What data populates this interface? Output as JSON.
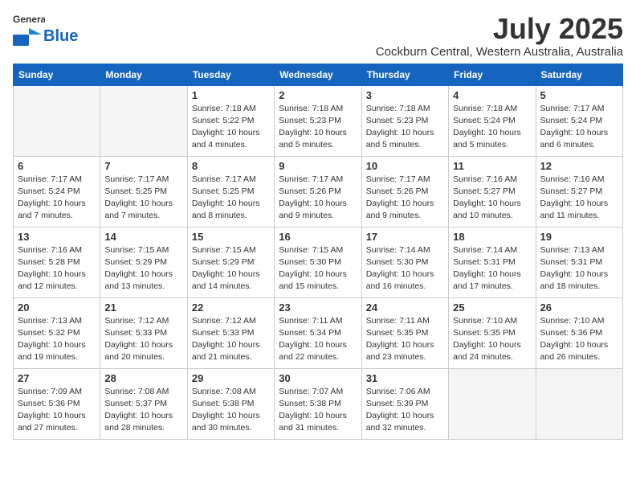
{
  "header": {
    "logo_general": "General",
    "logo_blue": "Blue",
    "month_title": "July 2025",
    "subtitle": "Cockburn Central, Western Australia, Australia"
  },
  "days_of_week": [
    "Sunday",
    "Monday",
    "Tuesday",
    "Wednesday",
    "Thursday",
    "Friday",
    "Saturday"
  ],
  "weeks": [
    [
      {
        "day": "",
        "info": ""
      },
      {
        "day": "",
        "info": ""
      },
      {
        "day": "1",
        "info": "Sunrise: 7:18 AM\nSunset: 5:22 PM\nDaylight: 10 hours and 4 minutes."
      },
      {
        "day": "2",
        "info": "Sunrise: 7:18 AM\nSunset: 5:23 PM\nDaylight: 10 hours and 5 minutes."
      },
      {
        "day": "3",
        "info": "Sunrise: 7:18 AM\nSunset: 5:23 PM\nDaylight: 10 hours and 5 minutes."
      },
      {
        "day": "4",
        "info": "Sunrise: 7:18 AM\nSunset: 5:24 PM\nDaylight: 10 hours and 5 minutes."
      },
      {
        "day": "5",
        "info": "Sunrise: 7:17 AM\nSunset: 5:24 PM\nDaylight: 10 hours and 6 minutes."
      }
    ],
    [
      {
        "day": "6",
        "info": "Sunrise: 7:17 AM\nSunset: 5:24 PM\nDaylight: 10 hours and 7 minutes."
      },
      {
        "day": "7",
        "info": "Sunrise: 7:17 AM\nSunset: 5:25 PM\nDaylight: 10 hours and 7 minutes."
      },
      {
        "day": "8",
        "info": "Sunrise: 7:17 AM\nSunset: 5:25 PM\nDaylight: 10 hours and 8 minutes."
      },
      {
        "day": "9",
        "info": "Sunrise: 7:17 AM\nSunset: 5:26 PM\nDaylight: 10 hours and 9 minutes."
      },
      {
        "day": "10",
        "info": "Sunrise: 7:17 AM\nSunset: 5:26 PM\nDaylight: 10 hours and 9 minutes."
      },
      {
        "day": "11",
        "info": "Sunrise: 7:16 AM\nSunset: 5:27 PM\nDaylight: 10 hours and 10 minutes."
      },
      {
        "day": "12",
        "info": "Sunrise: 7:16 AM\nSunset: 5:27 PM\nDaylight: 10 hours and 11 minutes."
      }
    ],
    [
      {
        "day": "13",
        "info": "Sunrise: 7:16 AM\nSunset: 5:28 PM\nDaylight: 10 hours and 12 minutes."
      },
      {
        "day": "14",
        "info": "Sunrise: 7:15 AM\nSunset: 5:29 PM\nDaylight: 10 hours and 13 minutes."
      },
      {
        "day": "15",
        "info": "Sunrise: 7:15 AM\nSunset: 5:29 PM\nDaylight: 10 hours and 14 minutes."
      },
      {
        "day": "16",
        "info": "Sunrise: 7:15 AM\nSunset: 5:30 PM\nDaylight: 10 hours and 15 minutes."
      },
      {
        "day": "17",
        "info": "Sunrise: 7:14 AM\nSunset: 5:30 PM\nDaylight: 10 hours and 16 minutes."
      },
      {
        "day": "18",
        "info": "Sunrise: 7:14 AM\nSunset: 5:31 PM\nDaylight: 10 hours and 17 minutes."
      },
      {
        "day": "19",
        "info": "Sunrise: 7:13 AM\nSunset: 5:31 PM\nDaylight: 10 hours and 18 minutes."
      }
    ],
    [
      {
        "day": "20",
        "info": "Sunrise: 7:13 AM\nSunset: 5:32 PM\nDaylight: 10 hours and 19 minutes."
      },
      {
        "day": "21",
        "info": "Sunrise: 7:12 AM\nSunset: 5:33 PM\nDaylight: 10 hours and 20 minutes."
      },
      {
        "day": "22",
        "info": "Sunrise: 7:12 AM\nSunset: 5:33 PM\nDaylight: 10 hours and 21 minutes."
      },
      {
        "day": "23",
        "info": "Sunrise: 7:11 AM\nSunset: 5:34 PM\nDaylight: 10 hours and 22 minutes."
      },
      {
        "day": "24",
        "info": "Sunrise: 7:11 AM\nSunset: 5:35 PM\nDaylight: 10 hours and 23 minutes."
      },
      {
        "day": "25",
        "info": "Sunrise: 7:10 AM\nSunset: 5:35 PM\nDaylight: 10 hours and 24 minutes."
      },
      {
        "day": "26",
        "info": "Sunrise: 7:10 AM\nSunset: 5:36 PM\nDaylight: 10 hours and 26 minutes."
      }
    ],
    [
      {
        "day": "27",
        "info": "Sunrise: 7:09 AM\nSunset: 5:36 PM\nDaylight: 10 hours and 27 minutes."
      },
      {
        "day": "28",
        "info": "Sunrise: 7:08 AM\nSunset: 5:37 PM\nDaylight: 10 hours and 28 minutes."
      },
      {
        "day": "29",
        "info": "Sunrise: 7:08 AM\nSunset: 5:38 PM\nDaylight: 10 hours and 30 minutes."
      },
      {
        "day": "30",
        "info": "Sunrise: 7:07 AM\nSunset: 5:38 PM\nDaylight: 10 hours and 31 minutes."
      },
      {
        "day": "31",
        "info": "Sunrise: 7:06 AM\nSunset: 5:39 PM\nDaylight: 10 hours and 32 minutes."
      },
      {
        "day": "",
        "info": ""
      },
      {
        "day": "",
        "info": ""
      }
    ]
  ]
}
